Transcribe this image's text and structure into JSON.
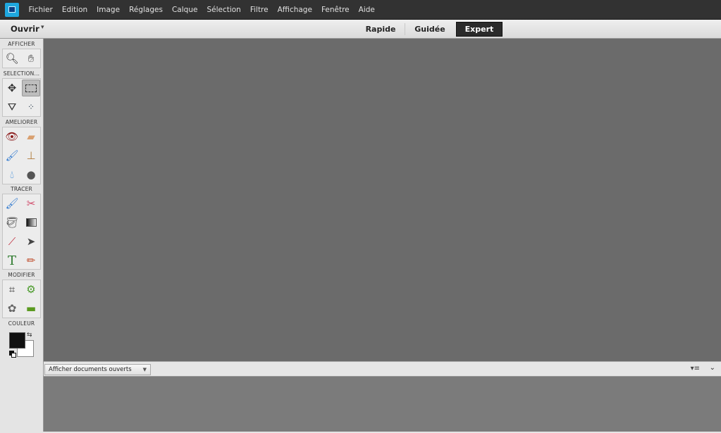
{
  "menubar": {
    "items": [
      "Fichier",
      "Edition",
      "Image",
      "Réglages",
      "Calque",
      "Sélection",
      "Filtre",
      "Affichage",
      "Fenêtre",
      "Aide"
    ]
  },
  "toolbar": {
    "open_label": "Ouvrir",
    "modes": {
      "rapide": "Rapide",
      "guidee": "Guidée",
      "expert": "Expert"
    },
    "active_mode": "Expert"
  },
  "tools": {
    "sections": {
      "afficher": "AFFICHER",
      "selection": "SELECTION...",
      "ameliorer": "AMELIORER",
      "tracer": "TRACER",
      "modifier": "MODIFIER",
      "couleur": "COULEUR"
    }
  },
  "colors": {
    "foreground": "#111111",
    "background": "#ffffff",
    "accent": "#1fa8e0"
  },
  "bin": {
    "select_value": "Afficher documents ouverts"
  }
}
